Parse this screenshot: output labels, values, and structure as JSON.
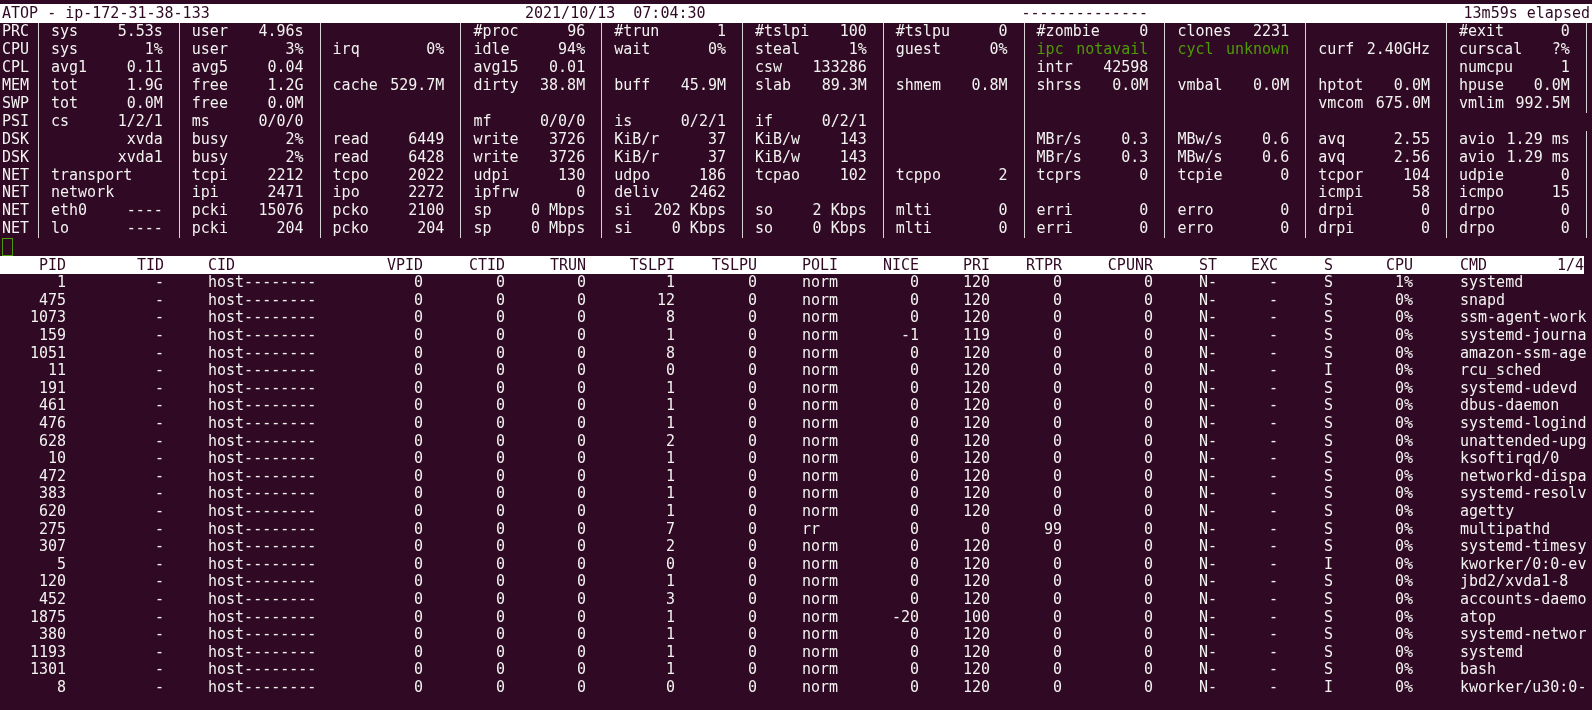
{
  "header": {
    "host": "ATOP - ip-172-31-38-133",
    "date": "2021/10/13",
    "time": "07:04:30",
    "separator": "--------------",
    "elapsed": "13m59s elapsed"
  },
  "system_lines": [
    {
      "label": "PRC",
      "cells": [
        {
          "key": "sys",
          "value": "5.53s"
        },
        {
          "key": "user",
          "value": "4.96s"
        },
        null,
        {
          "key": "#proc",
          "value": "96"
        },
        {
          "key": "#trun",
          "value": "1"
        },
        {
          "key": "#tslpi",
          "value": "100"
        },
        {
          "key": "#tslpu",
          "value": "0"
        },
        {
          "key": "#zombie",
          "value": "0"
        },
        {
          "key": "clones",
          "value": "2231"
        },
        null,
        {
          "key": "#exit",
          "value": "0"
        }
      ]
    },
    {
      "label": "CPU",
      "cells": [
        {
          "key": "sys",
          "value": "1%"
        },
        {
          "key": "user",
          "value": "3%"
        },
        {
          "key": "irq",
          "value": "0%"
        },
        {
          "key": "idle",
          "value": "94%"
        },
        {
          "key": "wait",
          "value": "0%"
        },
        {
          "key": "steal",
          "value": "1%"
        },
        {
          "key": "guest",
          "value": "0%"
        },
        {
          "key": "ipc",
          "value": "notavail",
          "color": "#4e9a06"
        },
        {
          "key": "cycl",
          "value": "unknown",
          "color": "#4e9a06"
        },
        {
          "key": "curf",
          "value": "2.40GHz"
        },
        {
          "key": "curscal",
          "value": "?%"
        }
      ]
    },
    {
      "label": "CPL",
      "cells": [
        {
          "key": "avg1",
          "value": "0.11"
        },
        {
          "key": "avg5",
          "value": "0.04"
        },
        null,
        {
          "key": "avg15",
          "value": "0.01"
        },
        null,
        {
          "key": "csw",
          "value": "133286"
        },
        null,
        {
          "key": "intr",
          "value": "42598"
        },
        null,
        null,
        {
          "key": "numcpu",
          "value": "1"
        }
      ]
    },
    {
      "label": "MEM",
      "cells": [
        {
          "key": "tot",
          "value": "1.9G"
        },
        {
          "key": "free",
          "value": "1.2G"
        },
        {
          "key": "cache",
          "value": "529.7M"
        },
        {
          "key": "dirty",
          "value": "38.8M"
        },
        {
          "key": "buff",
          "value": "45.9M"
        },
        {
          "key": "slab",
          "value": "89.3M"
        },
        {
          "key": "shmem",
          "value": "0.8M"
        },
        {
          "key": "shrss",
          "value": "0.0M"
        },
        {
          "key": "vmbal",
          "value": "0.0M"
        },
        {
          "key": "hptot",
          "value": "0.0M"
        },
        {
          "key": "hpuse",
          "value": "0.0M"
        }
      ]
    },
    {
      "label": "SWP",
      "cells": [
        {
          "key": "tot",
          "value": "0.0M"
        },
        {
          "key": "free",
          "value": "0.0M"
        },
        null,
        null,
        null,
        null,
        null,
        null,
        null,
        {
          "key": "vmcom",
          "value": "675.0M"
        },
        {
          "key": "vmlim",
          "value": "992.5M"
        }
      ]
    },
    {
      "label": "PSI",
      "cells": [
        {
          "key": "cs",
          "value": "1/2/1"
        },
        {
          "key": "ms",
          "value": "0/0/0"
        },
        null,
        {
          "key": "mf",
          "value": "0/0/0"
        },
        {
          "key": "is",
          "value": "0/2/1"
        },
        {
          "key": "if",
          "value": "0/2/1"
        },
        null,
        null,
        null,
        null,
        null
      ]
    },
    {
      "label": "DSK",
      "cells": [
        {
          "value": "xvda"
        },
        {
          "key": "busy",
          "value": "2%"
        },
        {
          "key": "read",
          "value": "6449"
        },
        {
          "key": "write",
          "value": "3726"
        },
        {
          "key": "KiB/r",
          "value": "37"
        },
        {
          "key": "KiB/w",
          "value": "143"
        },
        null,
        {
          "key": "MBr/s",
          "value": "0.3"
        },
        {
          "key": "MBw/s",
          "value": "0.6"
        },
        {
          "key": "avq",
          "value": "2.55"
        },
        {
          "key": "avio",
          "value": "1.29 ms"
        }
      ]
    },
    {
      "label": "DSK",
      "cells": [
        {
          "value": "xvda1"
        },
        {
          "key": "busy",
          "value": "2%"
        },
        {
          "key": "read",
          "value": "6428"
        },
        {
          "key": "write",
          "value": "3726"
        },
        {
          "key": "KiB/r",
          "value": "37"
        },
        {
          "key": "KiB/w",
          "value": "143"
        },
        null,
        {
          "key": "MBr/s",
          "value": "0.3"
        },
        {
          "key": "MBw/s",
          "value": "0.6"
        },
        {
          "key": "avq",
          "value": "2.56"
        },
        {
          "key": "avio",
          "value": "1.29 ms"
        }
      ]
    },
    {
      "label": "NET",
      "cells": [
        {
          "key": "transport"
        },
        {
          "key": "tcpi",
          "value": "2212"
        },
        {
          "key": "tcpo",
          "value": "2022"
        },
        {
          "key": "udpi",
          "value": "130"
        },
        {
          "key": "udpo",
          "value": "186"
        },
        {
          "key": "tcpao",
          "value": "102"
        },
        {
          "key": "tcppo",
          "value": "2"
        },
        {
          "key": "tcprs",
          "value": "0"
        },
        {
          "key": "tcpie",
          "value": "0"
        },
        {
          "key": "tcpor",
          "value": "104"
        },
        {
          "key": "udpie",
          "value": "0"
        }
      ]
    },
    {
      "label": "NET",
      "cells": [
        {
          "key": "network"
        },
        {
          "key": "ipi",
          "value": "2471"
        },
        {
          "key": "ipo",
          "value": "2272"
        },
        {
          "key": "ipfrw",
          "value": "0"
        },
        {
          "key": "deliv",
          "value": "2462"
        },
        null,
        null,
        null,
        null,
        {
          "key": "icmpi",
          "value": "58"
        },
        {
          "key": "icmpo",
          "value": "15"
        }
      ]
    },
    {
      "label": "NET",
      "cells": [
        {
          "key": "eth0",
          "value": "----"
        },
        {
          "key": "pcki",
          "value": "15076"
        },
        {
          "key": "pcko",
          "value": "2100"
        },
        {
          "key": "sp",
          "value": "0 Mbps"
        },
        {
          "key": "si",
          "value": "202 Kbps"
        },
        {
          "key": "so",
          "value": "2 Kbps"
        },
        {
          "key": "mlti",
          "value": "0"
        },
        {
          "key": "erri",
          "value": "0"
        },
        {
          "key": "erro",
          "value": "0"
        },
        {
          "key": "drpi",
          "value": "0"
        },
        {
          "key": "drpo",
          "value": "0"
        }
      ]
    },
    {
      "label": "NET",
      "cells": [
        {
          "key": "lo",
          "value": "----"
        },
        {
          "key": "pcki",
          "value": "204"
        },
        {
          "key": "pcko",
          "value": "204"
        },
        {
          "key": "sp",
          "value": "0 Mbps"
        },
        {
          "key": "si",
          "value": "0 Kbps"
        },
        {
          "key": "so",
          "value": "0 Kbps"
        },
        {
          "key": "mlti",
          "value": "0"
        },
        {
          "key": "erri",
          "value": "0"
        },
        {
          "key": "erro",
          "value": "0"
        },
        {
          "key": "drpi",
          "value": "0"
        },
        {
          "key": "drpo",
          "value": "0"
        }
      ]
    }
  ],
  "process_table": {
    "columns": [
      "PID",
      "TID",
      "CID",
      "VPID",
      "CTID",
      "TRUN",
      "TSLPI",
      "TSLPU",
      "POLI",
      "NICE",
      "PRI",
      "RTPR",
      "CPUNR",
      "ST",
      "EXC",
      "S",
      "CPU",
      "CMD"
    ],
    "page": "1/4",
    "rows": [
      [
        "1",
        "-",
        "host--------",
        "0",
        "0",
        "0",
        "1",
        "0",
        "norm",
        "0",
        "120",
        "0",
        "0",
        "N-",
        "-",
        "S",
        "1%",
        "systemd"
      ],
      [
        "475",
        "-",
        "host--------",
        "0",
        "0",
        "0",
        "12",
        "0",
        "norm",
        "0",
        "120",
        "0",
        "0",
        "N-",
        "-",
        "S",
        "0%",
        "snapd"
      ],
      [
        "1073",
        "-",
        "host--------",
        "0",
        "0",
        "0",
        "8",
        "0",
        "norm",
        "0",
        "120",
        "0",
        "0",
        "N-",
        "-",
        "S",
        "0%",
        "ssm-agent-work"
      ],
      [
        "159",
        "-",
        "host--------",
        "0",
        "0",
        "0",
        "1",
        "0",
        "norm",
        "-1",
        "119",
        "0",
        "0",
        "N-",
        "-",
        "S",
        "0%",
        "systemd-journa"
      ],
      [
        "1051",
        "-",
        "host--------",
        "0",
        "0",
        "0",
        "8",
        "0",
        "norm",
        "0",
        "120",
        "0",
        "0",
        "N-",
        "-",
        "S",
        "0%",
        "amazon-ssm-age"
      ],
      [
        "11",
        "-",
        "host--------",
        "0",
        "0",
        "0",
        "0",
        "0",
        "norm",
        "0",
        "120",
        "0",
        "0",
        "N-",
        "-",
        "I",
        "0%",
        "rcu_sched"
      ],
      [
        "191",
        "-",
        "host--------",
        "0",
        "0",
        "0",
        "1",
        "0",
        "norm",
        "0",
        "120",
        "0",
        "0",
        "N-",
        "-",
        "S",
        "0%",
        "systemd-udevd"
      ],
      [
        "461",
        "-",
        "host--------",
        "0",
        "0",
        "0",
        "1",
        "0",
        "norm",
        "0",
        "120",
        "0",
        "0",
        "N-",
        "-",
        "S",
        "0%",
        "dbus-daemon"
      ],
      [
        "476",
        "-",
        "host--------",
        "0",
        "0",
        "0",
        "1",
        "0",
        "norm",
        "0",
        "120",
        "0",
        "0",
        "N-",
        "-",
        "S",
        "0%",
        "systemd-logind"
      ],
      [
        "628",
        "-",
        "host--------",
        "0",
        "0",
        "0",
        "2",
        "0",
        "norm",
        "0",
        "120",
        "0",
        "0",
        "N-",
        "-",
        "S",
        "0%",
        "unattended-upg"
      ],
      [
        "10",
        "-",
        "host--------",
        "0",
        "0",
        "0",
        "1",
        "0",
        "norm",
        "0",
        "120",
        "0",
        "0",
        "N-",
        "-",
        "S",
        "0%",
        "ksoftirqd/0"
      ],
      [
        "472",
        "-",
        "host--------",
        "0",
        "0",
        "0",
        "1",
        "0",
        "norm",
        "0",
        "120",
        "0",
        "0",
        "N-",
        "-",
        "S",
        "0%",
        "networkd-dispa"
      ],
      [
        "383",
        "-",
        "host--------",
        "0",
        "0",
        "0",
        "1",
        "0",
        "norm",
        "0",
        "120",
        "0",
        "0",
        "N-",
        "-",
        "S",
        "0%",
        "systemd-resolv"
      ],
      [
        "620",
        "-",
        "host--------",
        "0",
        "0",
        "0",
        "1",
        "0",
        "norm",
        "0",
        "120",
        "0",
        "0",
        "N-",
        "-",
        "S",
        "0%",
        "agetty"
      ],
      [
        "275",
        "-",
        "host--------",
        "0",
        "0",
        "0",
        "7",
        "0",
        "rr",
        "0",
        "0",
        "99",
        "0",
        "N-",
        "-",
        "S",
        "0%",
        "multipathd"
      ],
      [
        "307",
        "-",
        "host--------",
        "0",
        "0",
        "0",
        "2",
        "0",
        "norm",
        "0",
        "120",
        "0",
        "0",
        "N-",
        "-",
        "S",
        "0%",
        "systemd-timesy"
      ],
      [
        "5",
        "-",
        "host--------",
        "0",
        "0",
        "0",
        "0",
        "0",
        "norm",
        "0",
        "120",
        "0",
        "0",
        "N-",
        "-",
        "I",
        "0%",
        "kworker/0:0-ev"
      ],
      [
        "120",
        "-",
        "host--------",
        "0",
        "0",
        "0",
        "1",
        "0",
        "norm",
        "0",
        "120",
        "0",
        "0",
        "N-",
        "-",
        "S",
        "0%",
        "jbd2/xvda1-8"
      ],
      [
        "452",
        "-",
        "host--------",
        "0",
        "0",
        "0",
        "3",
        "0",
        "norm",
        "0",
        "120",
        "0",
        "0",
        "N-",
        "-",
        "S",
        "0%",
        "accounts-daemo"
      ],
      [
        "1875",
        "-",
        "host--------",
        "0",
        "0",
        "0",
        "1",
        "0",
        "norm",
        "-20",
        "100",
        "0",
        "0",
        "N-",
        "-",
        "S",
        "0%",
        "atop"
      ],
      [
        "380",
        "-",
        "host--------",
        "0",
        "0",
        "0",
        "1",
        "0",
        "norm",
        "0",
        "120",
        "0",
        "0",
        "N-",
        "-",
        "S",
        "0%",
        "systemd-networ"
      ],
      [
        "1193",
        "-",
        "host--------",
        "0",
        "0",
        "0",
        "1",
        "0",
        "norm",
        "0",
        "120",
        "0",
        "0",
        "N-",
        "-",
        "S",
        "0%",
        "systemd"
      ],
      [
        "1301",
        "-",
        "host--------",
        "0",
        "0",
        "0",
        "1",
        "0",
        "norm",
        "0",
        "120",
        "0",
        "0",
        "N-",
        "-",
        "S",
        "0%",
        "bash"
      ],
      [
        "8",
        "-",
        "host--------",
        "0",
        "0",
        "0",
        "0",
        "0",
        "norm",
        "0",
        "120",
        "0",
        "0",
        "N-",
        "-",
        "I",
        "0%",
        "kworker/u30:0-"
      ]
    ]
  }
}
